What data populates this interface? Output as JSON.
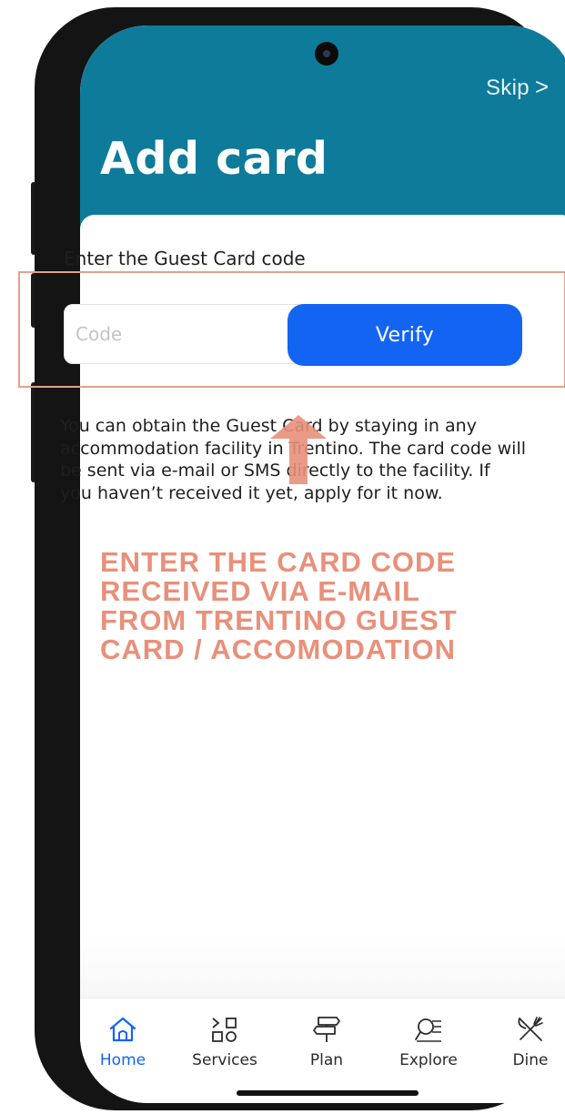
{
  "header": {
    "skip_label": "Skip",
    "skip_chevron": ">",
    "title": "Add card"
  },
  "form": {
    "label": "Enter the Guest Card code",
    "code_placeholder": "Code",
    "code_value": "",
    "verify_label": "Verify"
  },
  "info_text": "You can obtain the Guest Card by staying in any accommodation facility in Trentino. The card code will be sent via e-mail or SMS directly to the facility. If you haven’t received it yet, apply for it  now.",
  "annotation": {
    "lines": [
      "ENTER THE CARD CODE",
      "RECEIVED VIA E-MAIL",
      "FROM TRENTINO GUEST",
      "CARD / ACCOMODATION"
    ],
    "color": "#e8907a"
  },
  "tabbar": {
    "items": [
      {
        "label": "Home",
        "icon": "home-icon",
        "active": true
      },
      {
        "label": "Services",
        "icon": "services-icon",
        "active": false
      },
      {
        "label": "Plan",
        "icon": "signpost-icon",
        "active": false
      },
      {
        "label": "Explore",
        "icon": "explore-icon",
        "active": false
      },
      {
        "label": "Dine",
        "icon": "fork-knife-icon",
        "active": false
      }
    ]
  },
  "colors": {
    "header_bg": "#0f7b9a",
    "accent_blue": "#1464f4",
    "highlight_border": "#e3a08d"
  }
}
